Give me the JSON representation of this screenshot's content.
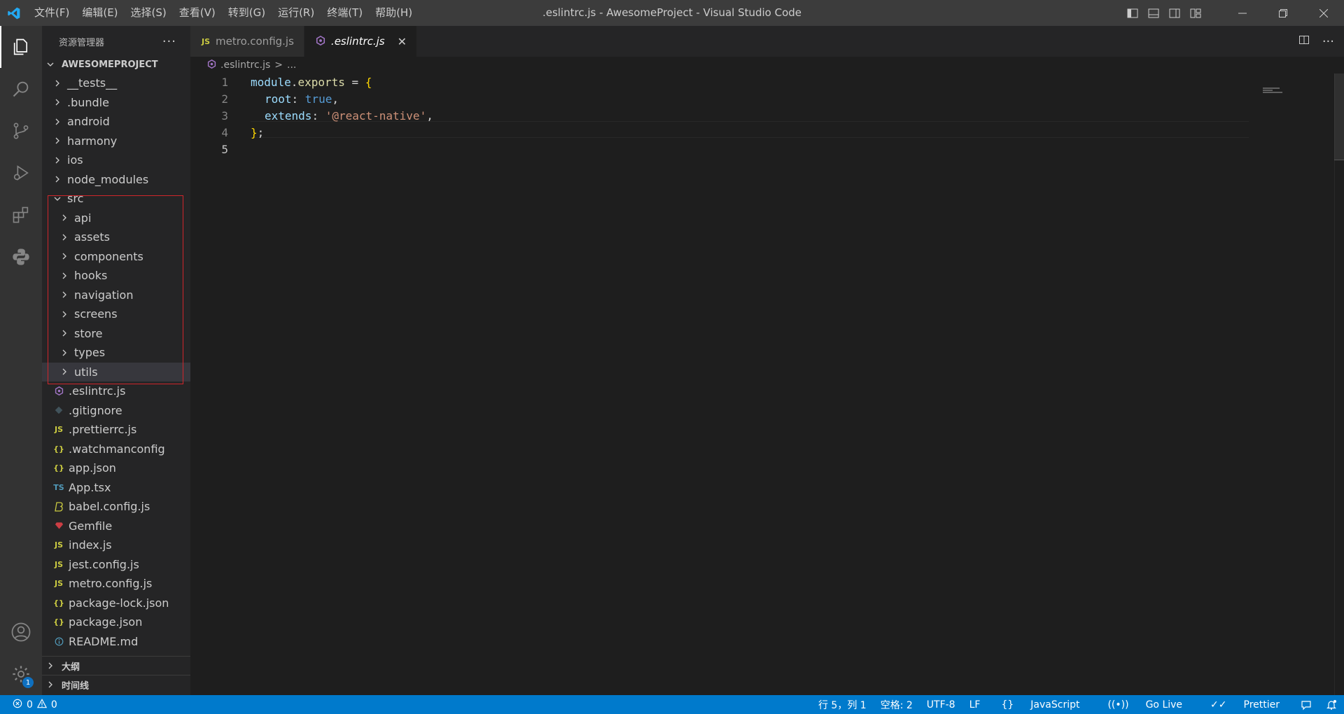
{
  "titlebar": {
    "menu": [
      "文件(F)",
      "编辑(E)",
      "选择(S)",
      "查看(V)",
      "转到(G)",
      "运行(R)",
      "终端(T)",
      "帮助(H)"
    ],
    "title": ".eslintrc.js - AwesomeProject - Visual Studio Code"
  },
  "activity": {
    "settings_badge": "1"
  },
  "sidebar": {
    "header": "资源管理器",
    "project": "AWESOMEPROJECT",
    "folders": [
      "__tests__",
      ".bundle",
      "android",
      "harmony",
      "ios",
      "node_modules"
    ],
    "src": "src",
    "src_children": [
      "api",
      "assets",
      "components",
      "hooks",
      "navigation",
      "screens",
      "store",
      "types",
      "utils"
    ],
    "files": [
      {
        "name": ".eslintrc.js",
        "icon": "eslint-icon"
      },
      {
        "name": ".gitignore",
        "icon": "git-icon"
      },
      {
        "name": ".prettierrc.js",
        "icon": "js-icon"
      },
      {
        "name": ".watchmanconfig",
        "icon": "json-icon"
      },
      {
        "name": "app.json",
        "icon": "json-icon"
      },
      {
        "name": "App.tsx",
        "icon": "ts-icon"
      },
      {
        "name": "babel.config.js",
        "icon": "babel-icon"
      },
      {
        "name": "Gemfile",
        "icon": "ruby-icon"
      },
      {
        "name": "index.js",
        "icon": "js-icon"
      },
      {
        "name": "jest.config.js",
        "icon": "js-icon"
      },
      {
        "name": "metro.config.js",
        "icon": "js-icon"
      },
      {
        "name": "package-lock.json",
        "icon": "json-icon"
      },
      {
        "name": "package.json",
        "icon": "json-icon"
      },
      {
        "name": "README.md",
        "icon": "info-icon"
      }
    ],
    "outline": "大纲",
    "timeline": "时间线"
  },
  "icons": {
    "js": "JS",
    "ts": "TS",
    "json": "{}"
  },
  "tabs": [
    {
      "label": "metro.config.js",
      "icon": "js-icon"
    },
    {
      "label": ".eslintrc.js",
      "icon": "eslint-icon"
    }
  ],
  "breadcrumb": {
    "file": ".eslintrc.js",
    "sep": ">",
    "more": "..."
  },
  "code": {
    "line_numbers": [
      "1",
      "2",
      "3",
      "4",
      "5"
    ],
    "l1": {
      "a": "module",
      "b": ".",
      "c": "exports",
      "d": " = ",
      "e": "{"
    },
    "l2": {
      "a": "root",
      "b": ": ",
      "c": "true",
      "d": ","
    },
    "l3": {
      "a": "extends",
      "b": ": ",
      "c": "'@react-native'",
      "d": ","
    },
    "l4": {
      "a": "}",
      "b": ";"
    }
  },
  "statusbar": {
    "errors": "0",
    "warnings": "0",
    "position": "行 5，列 1",
    "spaces": "空格: 2",
    "encoding": "UTF-8",
    "eol": "LF",
    "language": "JavaScript",
    "golive": "Go Live",
    "prettier": "Prettier"
  },
  "colors": {
    "accent": "#007acc",
    "highlight_border": "#d0262b",
    "js_yellow": "#cbcb41",
    "ts_blue": "#519aba",
    "eslint_purple": "#a074c4"
  }
}
